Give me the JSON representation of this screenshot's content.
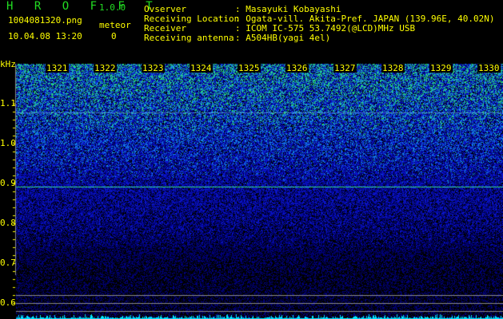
{
  "app": {
    "name": "H R O F F T",
    "version": "1.0.0"
  },
  "file": {
    "name": "1004081320.png",
    "datetime": "10.04.08 13:20"
  },
  "meteor": {
    "label": "meteor",
    "count": "0"
  },
  "info": [
    {
      "label": "Ovserver",
      "value": ": Masayuki Kobayashi"
    },
    {
      "label": "Receiving Location",
      "value": ": Ogata-vill. Akita-Pref. JAPAN (139.96E, 40.02N)"
    },
    {
      "label": "Receiver",
      "value": ": ICOM IC-575 53.7492(@LCD)MHz USB"
    },
    {
      "label": "Receiving antenna",
      "value": ": A504HB(yagi 4el)"
    }
  ],
  "axis": {
    "y_unit": "kHz",
    "y_ticks": [
      "1.1",
      "1.0",
      "0.9",
      "0.8",
      "0.7",
      "0.6"
    ],
    "x_ticks": [
      "1321",
      "1322",
      "1323",
      "1324",
      "1325",
      "1326",
      "1327",
      "1328",
      "1329",
      "1330"
    ]
  },
  "colors": {
    "text": "#ffff00",
    "title": "#22dd22",
    "signal_line": "#33dd99",
    "histogram": "#00e5ff"
  }
}
